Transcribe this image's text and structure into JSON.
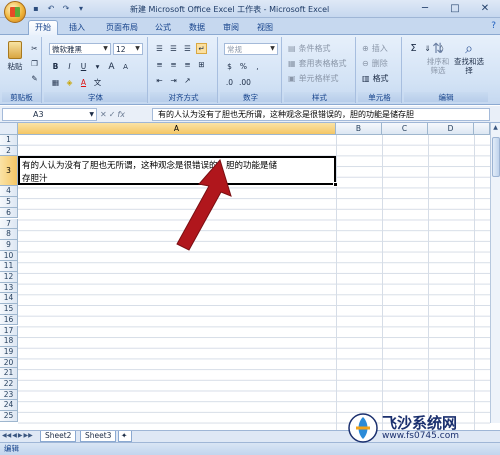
{
  "window": {
    "title": "新建 Microsoft Office Excel 工作表 - Microsoft Excel",
    "controls": [
      "─",
      "□",
      "✕"
    ]
  },
  "tabs": [
    "开始",
    "插入",
    "页面布局",
    "公式",
    "数据",
    "审阅",
    "视图"
  ],
  "active_tab": "开始",
  "ribbon": {
    "clipboard": {
      "label": "剪贴板",
      "paste": "粘贴"
    },
    "font": {
      "label": "字体",
      "font_name": "微软雅黑",
      "font_size": "12",
      "bold": "B",
      "italic": "I",
      "underline": "U",
      "grow": "A",
      "shrink": "A",
      "font_color": "A"
    },
    "alignment": {
      "label": "对齐方式"
    },
    "number": {
      "label": "数字",
      "format": "常规",
      "percent": "%",
      "comma": ",",
      "currency": "$"
    },
    "styles": {
      "label": "样式",
      "conditional": "条件格式",
      "table": "套用表格格式",
      "cell_styles": "单元格样式"
    },
    "cells": {
      "label": "单元格",
      "insert": "插入",
      "delete": "删除",
      "format": "格式"
    },
    "editing": {
      "label": "编辑",
      "sort": "排序和筛选",
      "find": "查找和选择",
      "sum": "Σ"
    }
  },
  "formula_bar": {
    "name_box": "A3",
    "fx": "fx",
    "content": "有的人认为没有了胆也无所谓，这种观念是很错误的，胆的功能是储存胆"
  },
  "grid": {
    "columns": [
      "A",
      "B",
      "C",
      "D"
    ],
    "selected_column": "A",
    "rows": [
      "1",
      "2",
      "3",
      "4",
      "5",
      "6",
      "7",
      "8",
      "9",
      "10",
      "11",
      "12",
      "13",
      "14",
      "15",
      "16",
      "17",
      "18",
      "19",
      "20",
      "21",
      "22",
      "23",
      "24",
      "25"
    ],
    "selected_row": "3",
    "cell_a3_line1": "有的人认为没有了胆也无所谓，这种观念是很错误的，胆的功能是储",
    "cell_a3_line2": "存胆汁"
  },
  "sheets": [
    "Sheet2",
    "Sheet3"
  ],
  "status": "编辑",
  "watermark": {
    "brand": "飞沙系统网",
    "url": "www.fs0745.com"
  },
  "colors": {
    "accent": "#15428b",
    "arrow": "#b0161c",
    "selection_header": "#f4c665"
  }
}
